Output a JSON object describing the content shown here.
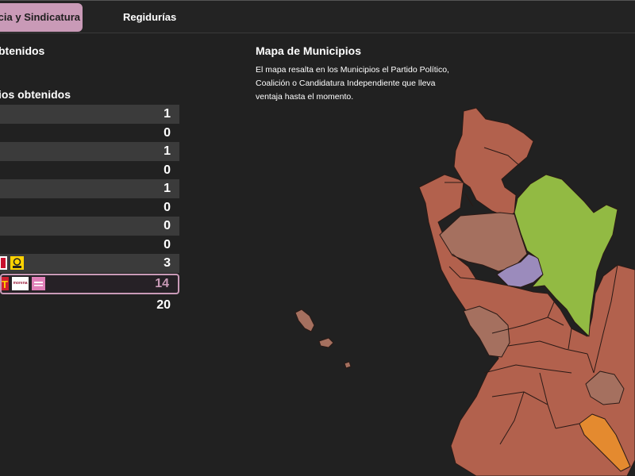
{
  "tabs": [
    {
      "label": "cia y Sindicatura",
      "active": true
    },
    {
      "label": "Regidurías",
      "active": false
    }
  ],
  "left": {
    "heading1": "btenidos",
    "heading2": "ios obtenidos",
    "rows": [
      {
        "value": "1"
      },
      {
        "value": "0"
      },
      {
        "value": "1"
      },
      {
        "value": "0"
      },
      {
        "value": "1"
      },
      {
        "value": "0"
      },
      {
        "value": "0"
      },
      {
        "value": "0"
      },
      {
        "value": "3"
      },
      {
        "value": "14"
      }
    ],
    "total": "20",
    "logos": {
      "morena_text": "morena"
    }
  },
  "map": {
    "title": "Mapa de Municipios",
    "description": "El mapa resalta en los Municipios el Partido Político, Coalición o Candidatura Independiente que lleva ventaja hasta el momento.",
    "colors": {
      "main": "#b2614d",
      "light": "#a5705f",
      "green": "#92ba43",
      "purple": "#9b8bbc",
      "orange": "#e48a2f",
      "border": "#2a1a16"
    }
  },
  "colors": {
    "accent": "#c99ab7",
    "background": "#212121",
    "row_shade": "#3b3b3b"
  }
}
